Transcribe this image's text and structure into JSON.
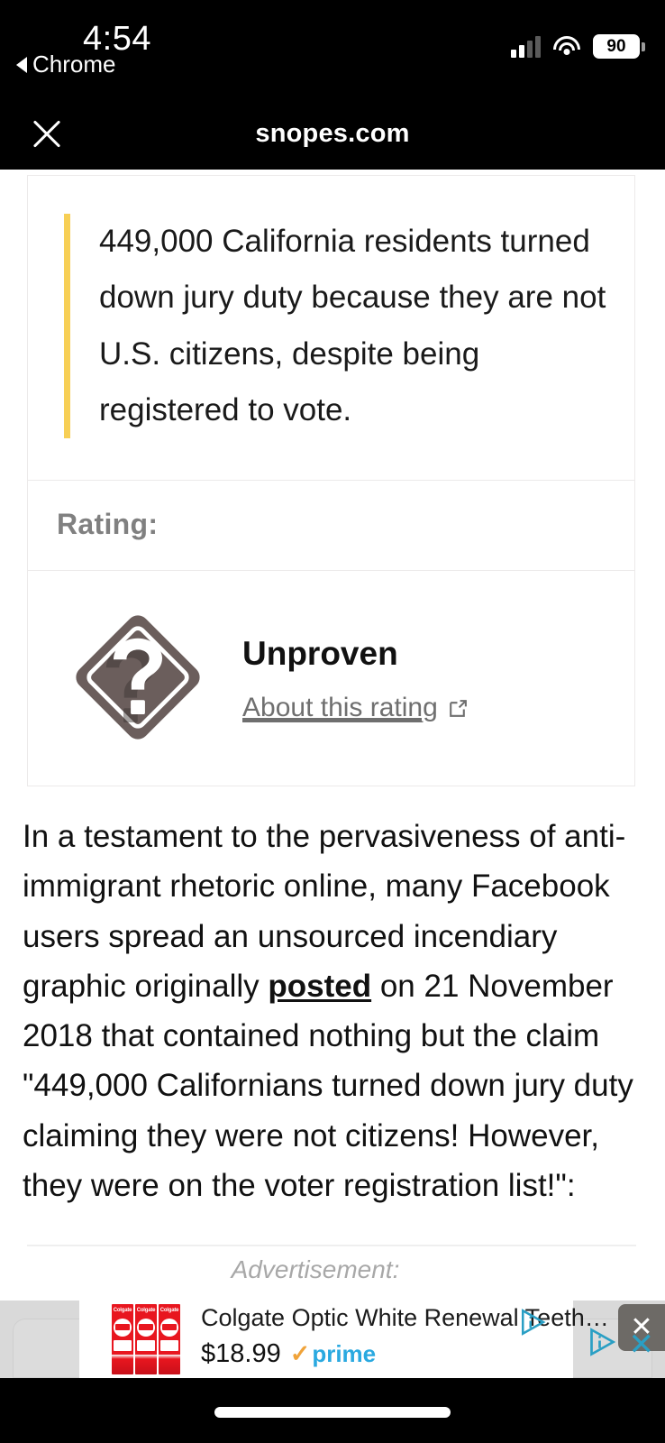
{
  "status_bar": {
    "time": "4:54",
    "back_app": "Chrome",
    "battery_level": "90",
    "icons": [
      "signal-bars-icon",
      "wifi-icon",
      "battery-icon"
    ]
  },
  "browser_header": {
    "title": "snopes.com",
    "close_label": "✕"
  },
  "claim_card": {
    "claim_text": "449,000 California residents turned down jury duty because they are not U.S. citizens, despite being registered to vote.",
    "accent_color": "#f7cf55",
    "rating_label": "Rating:",
    "verdict_name": "Unproven",
    "about_link": "About this rating",
    "badge_icon": "question-mark-diamond-icon",
    "badge_color": "#6b5e5c",
    "external_link_icon": "external-link-icon"
  },
  "article": {
    "paragraph_parts": [
      {
        "type": "text",
        "value": "In a testament to the pervasiveness of anti-immigrant rhetoric online, many Facebook users spread an unsourced incendiary graphic originally "
      },
      {
        "type": "link",
        "value": "posted"
      },
      {
        "type": "text",
        "value": " on 21 November 2018 that contained nothing but the claim \"449,000 Californians turned down jury duty claiming they were not citizens! However, they were on the voter registration list!\":"
      }
    ]
  },
  "advertisement": {
    "label": "Advertisement:",
    "product_title": "Colgate Optic White Renewal Teeth…",
    "price": "$18.99",
    "prime_check": "✓",
    "prime_label": "prime",
    "product_brand": "Colgate",
    "close_glyph": "✕",
    "adchoices_icon": "adchoices-icon",
    "close_icon": "close-icon",
    "accent_teal": "#2a9fc4",
    "prime_blue": "#2aa9e0",
    "prime_orange": "#f0a33a"
  },
  "home_bar": {
    "indicator": "home-indicator"
  }
}
